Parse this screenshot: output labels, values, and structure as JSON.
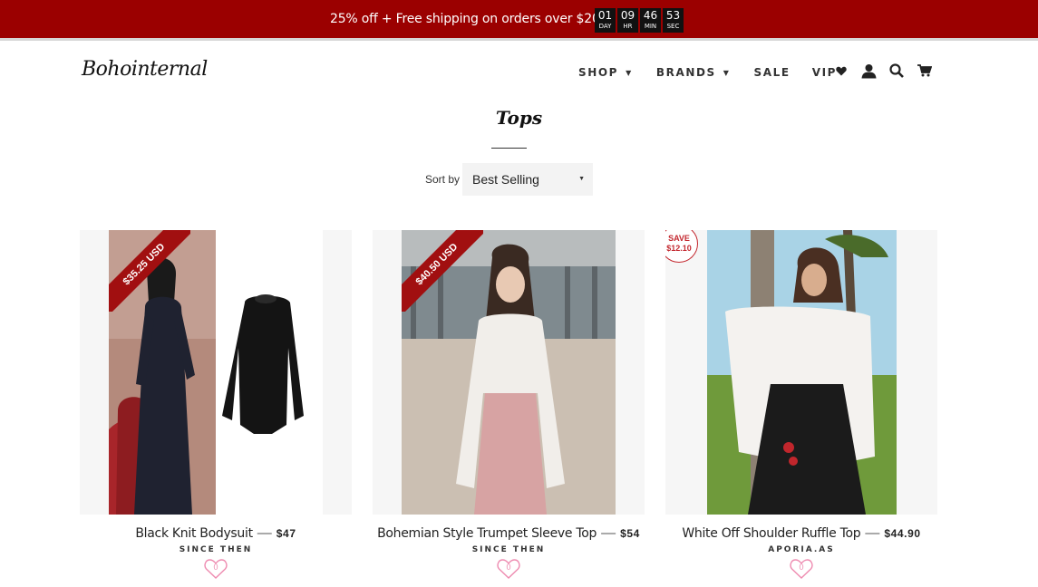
{
  "promo": {
    "text": "25% off + Free shipping on orders over $200",
    "countdown": [
      {
        "value": "01",
        "unit": "DAY"
      },
      {
        "value": "09",
        "unit": "HR"
      },
      {
        "value": "46",
        "unit": "MIN"
      },
      {
        "value": "53",
        "unit": "SEC"
      }
    ],
    "background": "#9b0000"
  },
  "header": {
    "logo": "Bohointernal",
    "nav": [
      {
        "label": "SHOP",
        "dropdown": true
      },
      {
        "label": "BRANDS",
        "dropdown": true
      },
      {
        "label": "SALE",
        "dropdown": false
      },
      {
        "label": "VIP",
        "dropdown": false
      }
    ],
    "icons": [
      "heart-icon",
      "account-icon",
      "search-icon",
      "cart-icon"
    ]
  },
  "collection": {
    "title": "Tops",
    "sort_label": "Sort by",
    "sort_value": "Best Selling"
  },
  "products": [
    {
      "name": "Black Knit Bodysuit",
      "price": "$47",
      "vendor": "SINCE THEN",
      "badge": "$35.25 USD",
      "badge_type": "ribbon",
      "wishlist_count": "0"
    },
    {
      "name": "Bohemian Style Trumpet Sleeve Top",
      "price": "$54",
      "vendor": "SINCE THEN",
      "badge": "$40.50 USD",
      "badge_type": "ribbon",
      "wishlist_count": "0"
    },
    {
      "name": "White Off Shoulder Ruffle Top",
      "price": "$44.90",
      "vendor": "APORIA.AS",
      "badge_line1": "SAVE",
      "badge_line2": "$12.10",
      "badge_type": "circle",
      "wishlist_count": "0"
    }
  ],
  "colors": {
    "accent": "#a10f10",
    "wishlist": "#ee8bb0"
  }
}
